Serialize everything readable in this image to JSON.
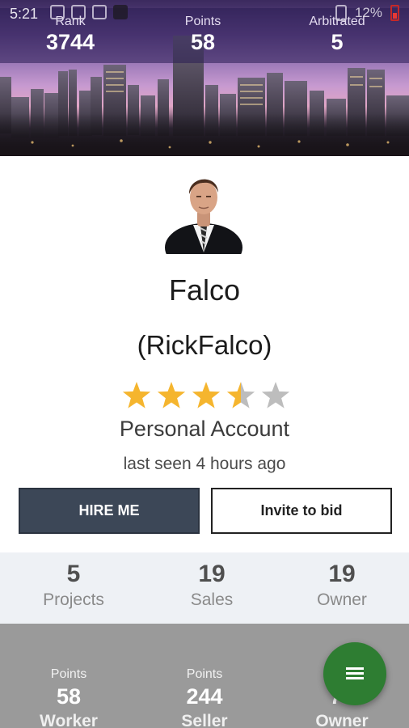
{
  "status_bar": {
    "time": "5:21",
    "battery_percent": "12%",
    "icons": [
      "notification-icon",
      "android-icon",
      "whatsapp-icon",
      "app-icon",
      "vibrate-icon",
      "battery-low-icon"
    ]
  },
  "header_stats": [
    {
      "label": "Rank",
      "value": "3744"
    },
    {
      "label": "Points",
      "value": "58"
    },
    {
      "label": "Arbitrated",
      "value": "5"
    }
  ],
  "profile": {
    "name": "Falco",
    "username": "(RickFalco)",
    "rating": 3.5,
    "rating_max": 5,
    "account_type": "Personal Account",
    "last_seen": "last seen 4 hours ago"
  },
  "actions": {
    "hire_label": "HIRE ME",
    "invite_label": "Invite to bid"
  },
  "counts": [
    {
      "value": "5",
      "label": "Projects"
    },
    {
      "value": "19",
      "label": "Sales"
    },
    {
      "value": "19",
      "label": "Owner"
    }
  ],
  "points": [
    {
      "label": "Points",
      "value": "58",
      "category": "Worker"
    },
    {
      "label": "Points",
      "value": "244",
      "category": "Seller"
    },
    {
      "label": "Points",
      "value": "78",
      "category": "Owner"
    }
  ],
  "colors": {
    "hire_button_bg": "#3c4757",
    "star_filled": "#f5b52e",
    "star_empty": "#bdbdbd",
    "fab_bg": "#2e7d32",
    "points_section_bg": "#9a9a9a",
    "counts_section_bg": "#eef1f5"
  },
  "fab": {
    "icon": "menu-icon"
  }
}
